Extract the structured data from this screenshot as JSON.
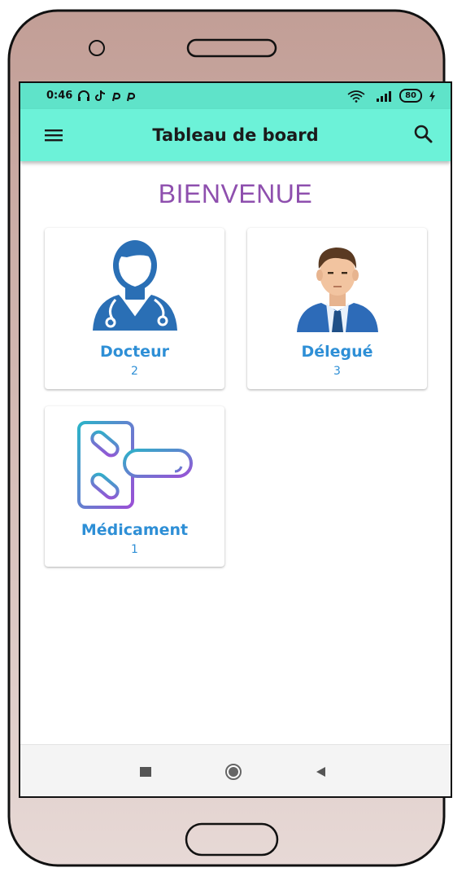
{
  "status_bar": {
    "time": "0:46",
    "battery": "80"
  },
  "app_bar": {
    "title": "Tableau de board",
    "menu_icon": "hamburger-menu-icon",
    "search_icon": "search-icon"
  },
  "welcome": "BIENVENUE",
  "cards": [
    {
      "label": "Docteur",
      "count": "2",
      "icon": "doctor-icon"
    },
    {
      "label": "Délegué",
      "count": "3",
      "icon": "businessman-icon"
    },
    {
      "label": "Médicament",
      "count": "1",
      "icon": "pills-icon"
    }
  ],
  "nav_bar": {
    "recents_icon": "square-recents-icon",
    "home_icon": "circle-home-icon",
    "back_icon": "triangle-back-icon"
  },
  "colors": {
    "status_bar": "#5fe3c9",
    "app_bar": "#6cf2d8",
    "welcome": "#8e4fae",
    "card_text": "#2e8fd6",
    "phone_frame": "#c8a8a0"
  }
}
